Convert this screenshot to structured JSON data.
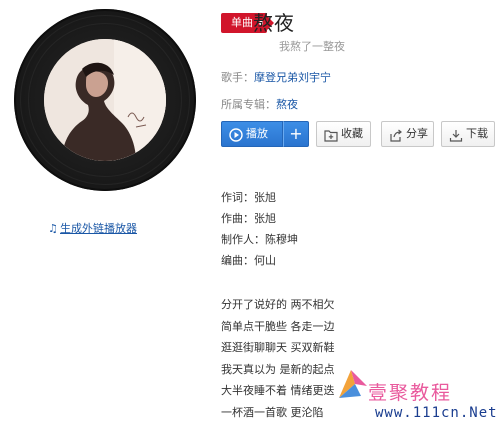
{
  "badge": "单曲",
  "title": "熬夜",
  "subtitle": "我熬了一整夜",
  "singer": {
    "label": "歌手：",
    "value": "摩登兄弟刘宇宁"
  },
  "album": {
    "label": "所属专辑：",
    "value": "熬夜"
  },
  "buttons": {
    "play": "播放",
    "add": "+",
    "favorite": "收藏",
    "share": "分享",
    "download": "下载"
  },
  "external_player_link": "生成外链播放器",
  "credits": [
    "作词：张旭",
    "作曲：张旭",
    "制作人：陈穆坤",
    "编曲：何山"
  ],
  "lyrics": [
    "分开了说好的 两不相欠",
    "简单点干脆些 各走一边",
    "逛逛街聊聊天 买双新鞋",
    "我天真以为 是新的起点",
    "大半夜睡不着 情绪更迭",
    "一杯酒一首歌 更沦陷"
  ],
  "watermark": {
    "brand": "壹聚教程",
    "url": "www.111cn.Net"
  },
  "colors": {
    "badge": "#d1152b",
    "link": "#1a57a6",
    "play_button": "#2a74cf",
    "watermark": "#e95a9d"
  },
  "icons": {
    "play": "play-circle-icon",
    "favorite": "add-folder-icon",
    "share": "share-icon",
    "download": "download-icon",
    "link": "music-note-icon"
  }
}
